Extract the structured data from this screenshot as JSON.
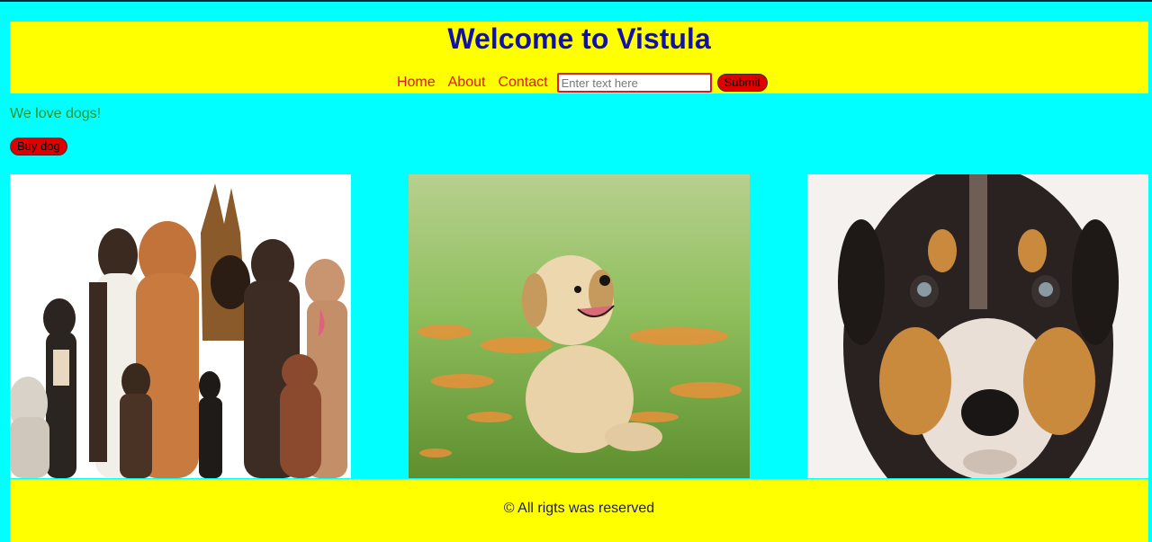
{
  "header": {
    "title": "Welcome to Vistula",
    "nav": [
      {
        "label": "Home"
      },
      {
        "label": "About"
      },
      {
        "label": "Contact"
      }
    ],
    "search": {
      "placeholder": "Enter text here",
      "value": ""
    },
    "submit_label": "Submit"
  },
  "main": {
    "tagline": "We love dogs!",
    "buy_label": "Buy dog",
    "images": [
      {
        "subject": "group of dogs"
      },
      {
        "subject": "golden retriever puppy on grass"
      },
      {
        "subject": "close-up puppy face"
      }
    ]
  },
  "footer": {
    "copyright": "© All rigts was reserved"
  },
  "colors": {
    "page_bg": "#00ffff",
    "header_bg": "#ffff00",
    "title": "#1111aa",
    "nav_link": "#d81b1b",
    "button_bg": "#e00000",
    "tagline": "#2a8f2a",
    "footer_text": "#1a1a7a"
  }
}
